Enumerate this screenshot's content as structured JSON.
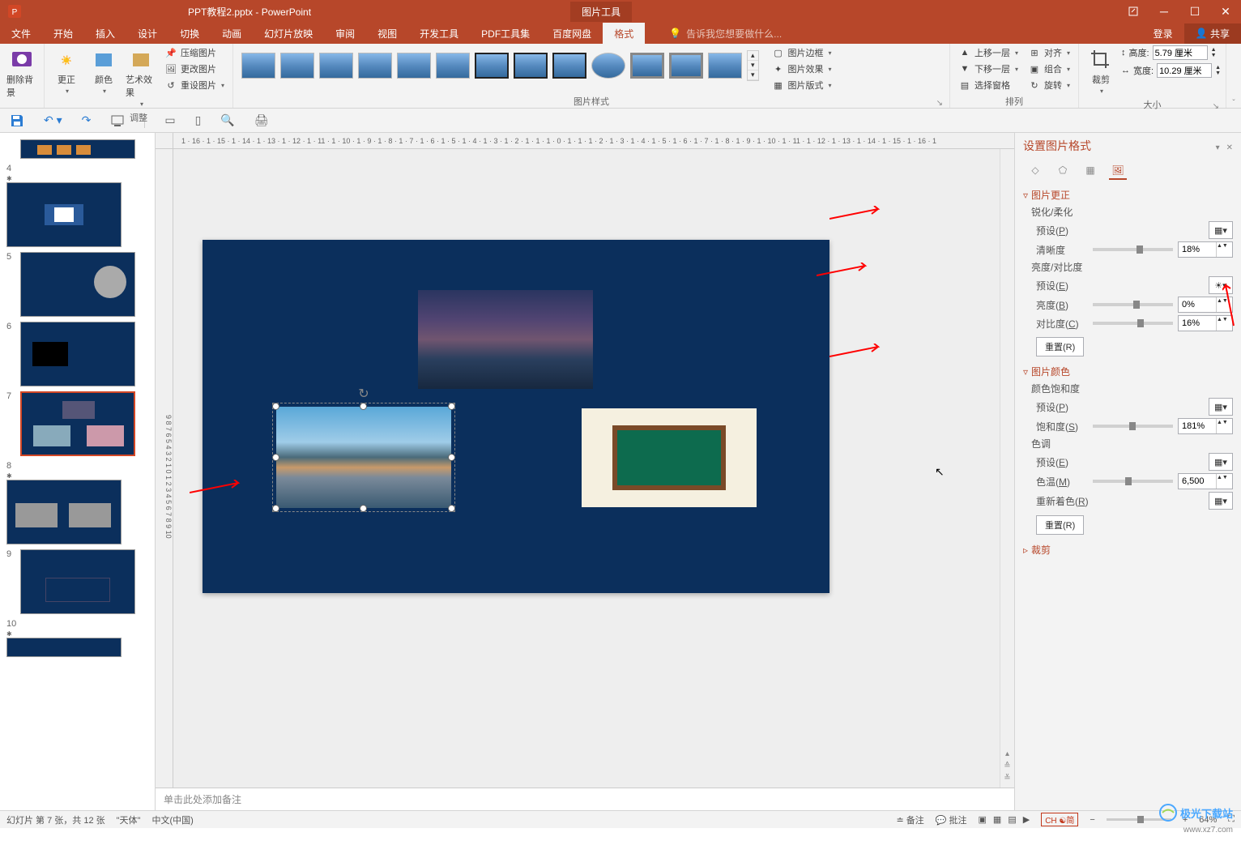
{
  "title": "PPT教程2.pptx - PowerPoint",
  "context_tab": "图片工具",
  "login_label": "登录",
  "share_label": "共享",
  "ribbon_tabs": [
    "文件",
    "开始",
    "插入",
    "设计",
    "切换",
    "动画",
    "幻灯片放映",
    "审阅",
    "视图",
    "开发工具",
    "PDF工具集",
    "百度网盘",
    "格式"
  ],
  "active_tab_index": 12,
  "search_placeholder": "告诉我您想要做什么...",
  "ribbon": {
    "remove_bg": "删除背景",
    "correct": "更正",
    "color": "颜色",
    "artistic": "艺术效果",
    "compress": "压缩图片",
    "change": "更改图片",
    "reset": "重设图片",
    "adjust_label": "调整",
    "style_label": "图片样式",
    "border": "图片边框",
    "effects": "图片效果",
    "layout": "图片版式",
    "bring_fwd": "上移一层",
    "send_back": "下移一层",
    "sel_pane": "选择窗格",
    "align": "对齐",
    "group": "组合",
    "rotate": "旋转",
    "arrange_label": "排列",
    "crop": "裁剪",
    "height_label": "高度:",
    "width_label": "宽度:",
    "height_val": "5.79 厘米",
    "width_val": "10.29 厘米",
    "size_label": "大小"
  },
  "h_ruler_text": "1 · 16 · 1 · 15 · 1 · 14 · 1 · 13 · 1 · 12 · 1 · 11 · 1 · 10 · 1 · 9 · 1 · 8 · 1 · 7 · 1 · 6 · 1 · 5 · 1 · 4 · 1 · 3 · 1 · 2 · 1 · 1 · 1 · 0 · 1 · 1 · 1 · 2 · 1 · 3 · 1 · 4 · 1 · 5 · 1 · 6 · 1 · 7 · 1 · 8 · 1 · 9 · 1 · 10 · 1 · 11 · 1 · 12 · 1 · 13 · 1 · 14 · 1 · 15 · 1 · 16 · 1",
  "thumbs": [
    {
      "num": "",
      "star": false
    },
    {
      "num": "4",
      "star": true
    },
    {
      "num": "5",
      "star": false
    },
    {
      "num": "6",
      "star": false
    },
    {
      "num": "7",
      "star": false,
      "active": true
    },
    {
      "num": "8",
      "star": true
    },
    {
      "num": "9",
      "star": false
    },
    {
      "num": "10",
      "star": true
    }
  ],
  "notes_placeholder": "单击此处添加备注",
  "format_pane": {
    "title": "设置图片格式",
    "sec_correct": "图片更正",
    "sharp_soft": "锐化/柔化",
    "preset_p": "预设(P)",
    "clarity": "清晰度",
    "clarity_val": "18%",
    "bright_contrast": "亮度/对比度",
    "preset_e": "预设(E)",
    "brightness": "亮度(B)",
    "brightness_val": "0%",
    "contrast": "对比度(C)",
    "contrast_val": "16%",
    "reset_r": "重置(R)",
    "sec_color": "图片颜色",
    "saturation_hdr": "颜色饱和度",
    "saturation": "饱和度(S)",
    "saturation_val": "181%",
    "tone": "色调",
    "temperature": "色温(M)",
    "temperature_val": "6,500",
    "recolor": "重新着色(R)",
    "sec_crop": "裁剪"
  },
  "status": {
    "slide_info": "幻灯片 第 7 张，共 12 张",
    "theme": "\"天体\"",
    "language": "中文(中国)",
    "notes_btn": "备注",
    "comments_btn": "批注",
    "ime": "CH ☯简",
    "zoom": "64%"
  },
  "watermark": "极光下载站",
  "watermark_url": "www.xz7.com"
}
